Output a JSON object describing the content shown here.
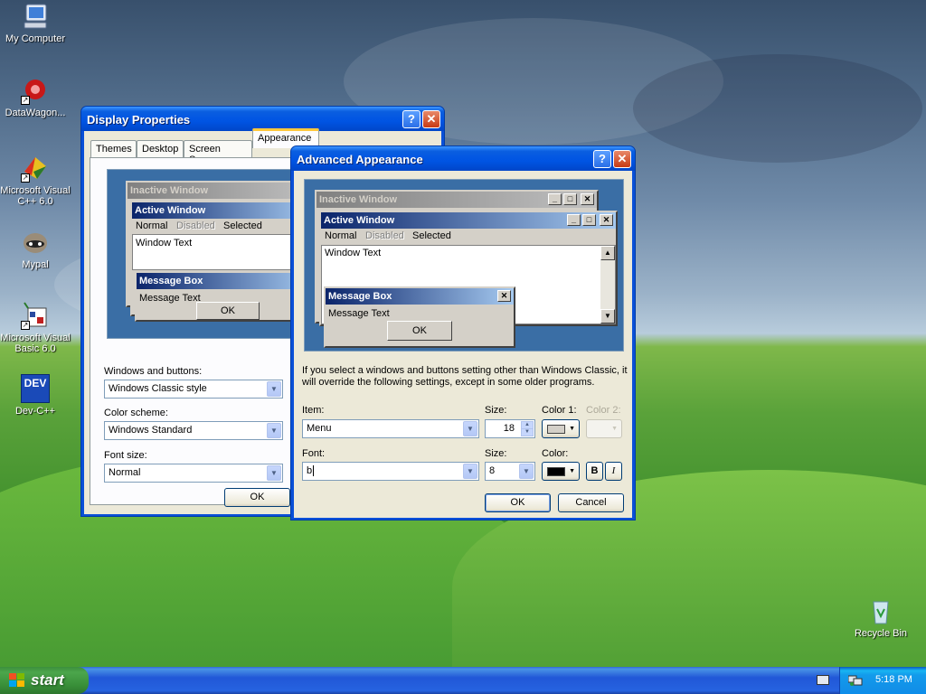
{
  "desktop": {
    "icons": [
      {
        "label": "My Computer",
        "icon": "my-computer-icon"
      },
      {
        "label": "DataWagon...",
        "icon": "datawagon-icon"
      },
      {
        "label": "Microsoft Visual C++ 6.0",
        "icon": "visual-cpp-icon"
      },
      {
        "label": "Mypal",
        "icon": "mypal-icon"
      },
      {
        "label": "Microsoft Visual Basic 6.0",
        "icon": "visual-basic-icon"
      },
      {
        "label": "Dev-C++",
        "icon": "dev-cpp-icon",
        "badge": "DEV"
      },
      {
        "label": "Recycle Bin",
        "icon": "recycle-bin-icon"
      }
    ]
  },
  "display_properties": {
    "title": "Display Properties",
    "help_glyph": "?",
    "close_glyph": "✕",
    "tabs": [
      "Themes",
      "Desktop",
      "Screen Saver",
      "Appearance"
    ],
    "selected_tab": "Appearance",
    "preview": {
      "inactive_window": "Inactive Window",
      "active_window": "Active Window",
      "menu": [
        "Normal",
        "Disabled",
        "Selected"
      ],
      "window_text": "Window Text",
      "message_box": "Message Box",
      "message_text": "Message Text",
      "ok": "OK"
    },
    "windows_and_buttons_label": "Windows and buttons:",
    "windows_and_buttons_value": "Windows Classic style",
    "color_scheme_label": "Color scheme:",
    "color_scheme_value": "Windows Standard",
    "font_size_label": "Font size:",
    "font_size_value": "Normal",
    "ok_button": "OK"
  },
  "advanced_appearance": {
    "title": "Advanced Appearance",
    "help_glyph": "?",
    "close_glyph": "✕",
    "preview": {
      "inactive_window": "Inactive Window",
      "active_window": "Active Window",
      "menu": [
        "Normal",
        "Disabled",
        "Selected"
      ],
      "window_text": "Window Text",
      "message_box": "Message Box",
      "message_text": "Message Text",
      "ok": "OK"
    },
    "notice": "If you select a windows and buttons setting other than Windows Classic, it will override the following settings, except in some older programs.",
    "item_label": "Item:",
    "item_value": "Menu",
    "item_size_label": "Size:",
    "item_size_value": "18",
    "color1_label": "Color 1:",
    "color2_label": "Color 2:",
    "color1_value": "#d4d0c8",
    "font_label": "Font:",
    "font_value": "b",
    "font_size_label": "Size:",
    "font_size_value": "8",
    "font_color_label": "Color:",
    "font_color_value": "#000000",
    "bold_glyph": "B",
    "italic_glyph": "I",
    "ok_button": "OK",
    "cancel_button": "Cancel"
  },
  "taskbar": {
    "start_label": "start",
    "clock": "5:18 PM"
  }
}
